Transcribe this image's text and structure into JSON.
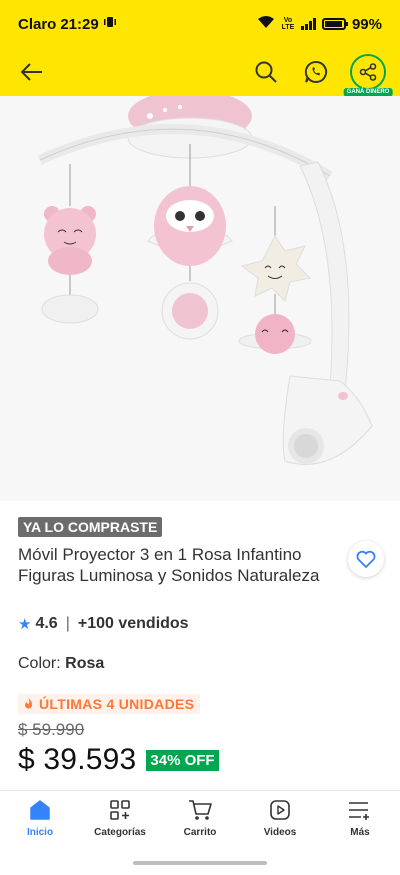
{
  "status_bar": {
    "carrier": "Claro",
    "time": "21:29",
    "network_label": "Vo LTE",
    "battery": "99%"
  },
  "top_nav": {
    "share_badge": "GANÁ DINERO"
  },
  "product": {
    "bought_badge": "YA LO COMPRASTE",
    "title": "Móvil Proyector 3 en 1 Rosa Infantino Figuras Luminosa y Sonidos Naturaleza",
    "rating": "4.6",
    "separator": "|",
    "sold": "+100 vendidos",
    "color_label": "Color:",
    "color_value": "Rosa",
    "stock_label": "ÚLTIMAS 4 UNIDADES",
    "old_price": "$ 59.990",
    "price": "$ 39.593",
    "discount": "34% OFF"
  },
  "bottom_nav": {
    "items": [
      {
        "label": "Inicio",
        "icon": "home-icon",
        "active": true
      },
      {
        "label": "Categorías",
        "icon": "categories-icon",
        "active": false
      },
      {
        "label": "Carrito",
        "icon": "cart-icon",
        "active": false
      },
      {
        "label": "Videos",
        "icon": "videos-icon",
        "active": false
      },
      {
        "label": "Más",
        "icon": "more-icon",
        "active": false
      }
    ]
  },
  "colors": {
    "brand_yellow": "#ffe600",
    "accent_blue": "#3483fa",
    "discount_green": "#00a650",
    "stock_orange": "#ff7733"
  }
}
